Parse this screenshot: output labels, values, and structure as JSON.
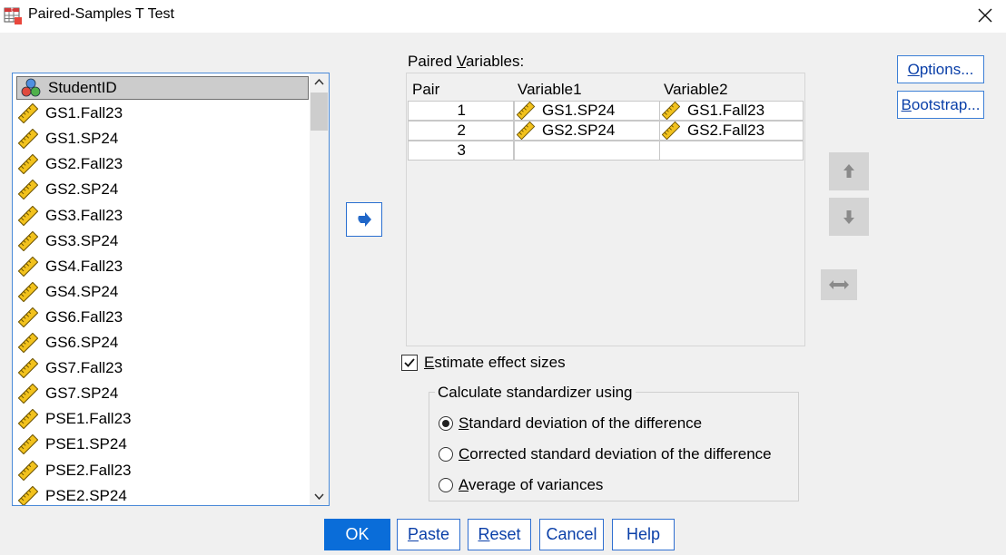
{
  "window": {
    "title": "Paired-Samples T Test"
  },
  "variables": [
    {
      "label": "StudentID",
      "type": "nominal",
      "selected": true
    },
    {
      "label": "GS1.Fall23",
      "type": "scale"
    },
    {
      "label": "GS1.SP24",
      "type": "scale"
    },
    {
      "label": "GS2.Fall23",
      "type": "scale"
    },
    {
      "label": "GS2.SP24",
      "type": "scale"
    },
    {
      "label": "GS3.Fall23",
      "type": "scale"
    },
    {
      "label": "GS3.SP24",
      "type": "scale"
    },
    {
      "label": "GS4.Fall23",
      "type": "scale"
    },
    {
      "label": "GS4.SP24",
      "type": "scale"
    },
    {
      "label": "GS6.Fall23",
      "type": "scale"
    },
    {
      "label": "GS6.SP24",
      "type": "scale"
    },
    {
      "label": "GS7.Fall23",
      "type": "scale"
    },
    {
      "label": "GS7.SP24",
      "type": "scale"
    },
    {
      "label": "PSE1.Fall23",
      "type": "scale"
    },
    {
      "label": "PSE1.SP24",
      "type": "scale"
    },
    {
      "label": "PSE2.Fall23",
      "type": "scale"
    },
    {
      "label": "PSE2.SP24",
      "type": "scale"
    }
  ],
  "paired": {
    "label_prefix": "Paired ",
    "label_mnemonic": "V",
    "label_rest": "ariables:",
    "columns": [
      "Pair",
      "Variable1",
      "Variable2"
    ],
    "rows": [
      {
        "pair": "1",
        "var1": "GS1.SP24",
        "var2": "GS1.Fall23"
      },
      {
        "pair": "2",
        "var1": "GS2.SP24",
        "var2": "GS2.Fall23"
      },
      {
        "pair": "3",
        "var1": "",
        "var2": ""
      }
    ]
  },
  "buttons": {
    "options": {
      "mnemonic": "O",
      "rest": "ptions..."
    },
    "bootstrap": {
      "mnemonic": "B",
      "rest": "ootstrap..."
    },
    "ok": "OK",
    "paste": {
      "mnemonic": "P",
      "rest": "aste"
    },
    "reset": {
      "mnemonic": "R",
      "rest": "eset"
    },
    "cancel": "Cancel",
    "help": "Help"
  },
  "effect_sizes": {
    "checked": true,
    "label_mnemonic": "E",
    "label_rest": "stimate effect sizes",
    "group_title": "Calculate standardizer using",
    "options": [
      {
        "mnemonic": "S",
        "rest": "tandard deviation of the difference",
        "selected": true
      },
      {
        "mnemonic": "C",
        "rest": "orrected standard deviation of the difference",
        "selected": false
      },
      {
        "mnemonic": "A",
        "rest": "verage of variances",
        "selected": false
      }
    ]
  },
  "colors": {
    "accent": "#0a6dd9",
    "link_text": "#0a3fa8",
    "disabled_button": "#d4d4d4"
  }
}
